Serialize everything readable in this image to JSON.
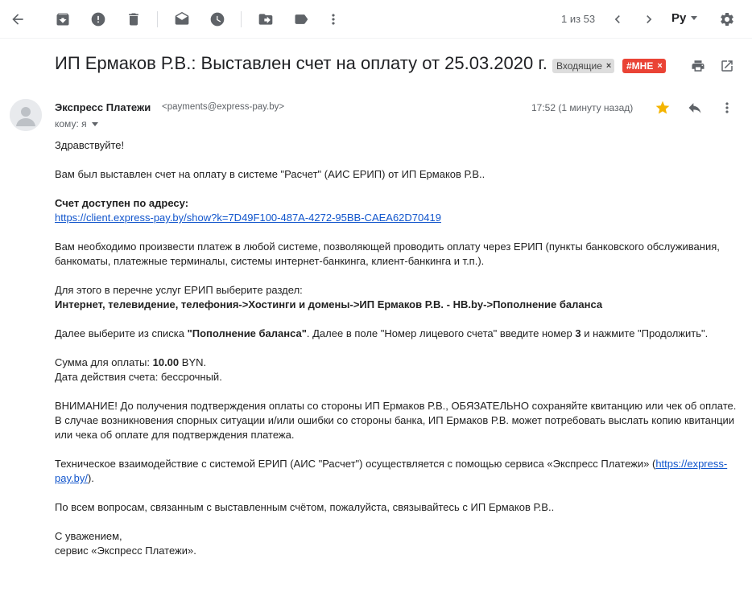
{
  "toolbar": {
    "pager": "1 из 53",
    "lang": "Ру",
    "icons": [
      "back-arrow-icon",
      "archive-icon",
      "report-spam-icon",
      "delete-icon",
      "mark-unread-icon",
      "snooze-icon",
      "move-to-icon",
      "label-icon",
      "more-vert-icon",
      "chevron-left-icon",
      "chevron-right-icon",
      "settings-gear-icon"
    ]
  },
  "subject": {
    "title": "ИП Ермаков Р.В.: Выставлен счет на оплату от 25.03.2020 г.",
    "labels": [
      {
        "text": "Входящие",
        "close": "×",
        "color": "#dddddd"
      },
      {
        "text": "#МНЕ",
        "close": "×",
        "color": "#ea4335"
      }
    ]
  },
  "message": {
    "sender_name": "Экспресс Платежи",
    "sender_email": "<payments@express-pay.by>",
    "to": "кому: я",
    "time": "17:52 (1 минуту назад)",
    "star_color": "#f4b400"
  },
  "body": {
    "greeting": "Здравствуйте!",
    "invoice_line": "Вам был выставлен счет на оплату в системе \"Расчет\" (АИС ЕРИП) от ИП Ермаков Р.В..",
    "available_label": "Счет доступен по адресу:",
    "invoice_link": "https://client.express-pay.by/show?k=7D49F100-487A-4272-95BB-CAEA62D70419",
    "payment_info": "Вам необходимо произвести платеж в любой системе, позволяющей проводить оплату через ЕРИП (пункты банковского обслуживания, банкоматы, платежные терминалы, системы интернет-банкинга, клиент-банкинга и т.п.).",
    "section_intro": "Для этого в перечне услуг ЕРИП выберите раздел:",
    "section_path": "Интернет, телевидение, телефония->Хостинги и домены->ИП Ермаков Р.В. - HB.by->Пополнение баланса",
    "select_pre": "Далее выберите из списка ",
    "select_bold": "\"Пополнение баланса\"",
    "select_mid": ". Далее в поле \"Номер лицевого счета\" введите номер ",
    "select_num": "3",
    "select_post": " и нажмите \"Продолжить\".",
    "amount_label": "Сумма для оплаты: ",
    "amount_value": "10.00",
    "amount_currency": " BYN.",
    "validity": "Дата действия счета: бессрочный.",
    "warning_1": "ВНИМАНИЕ! До получения подтверждения оплаты со стороны ИП Ермаков Р.В., ОБЯЗАТЕЛЬНО сохраняйте квитанцию или чек об оплате.",
    "warning_2": "В случае возникновения спорных ситуации и/или ошибки со стороны банка, ИП Ермаков Р.В. может потребовать выслать копию квитанции или чека об оплате для подтверждения платежа.",
    "tech_pre": "Техническое взаимодействие с системой ЕРИП (АИС \"Расчет\") осуществляется с помощью сервиса «Экспресс Платежи» (",
    "tech_link": "https://express-pay.by/",
    "tech_post": ").",
    "questions": "По всем вопросам, связанным с выставленным счётом, пожалуйста, связывайтесь с ИП Ермаков Р.В..",
    "regards": "С уважением,",
    "signature": "сервис «Экспресс Платежи»."
  }
}
